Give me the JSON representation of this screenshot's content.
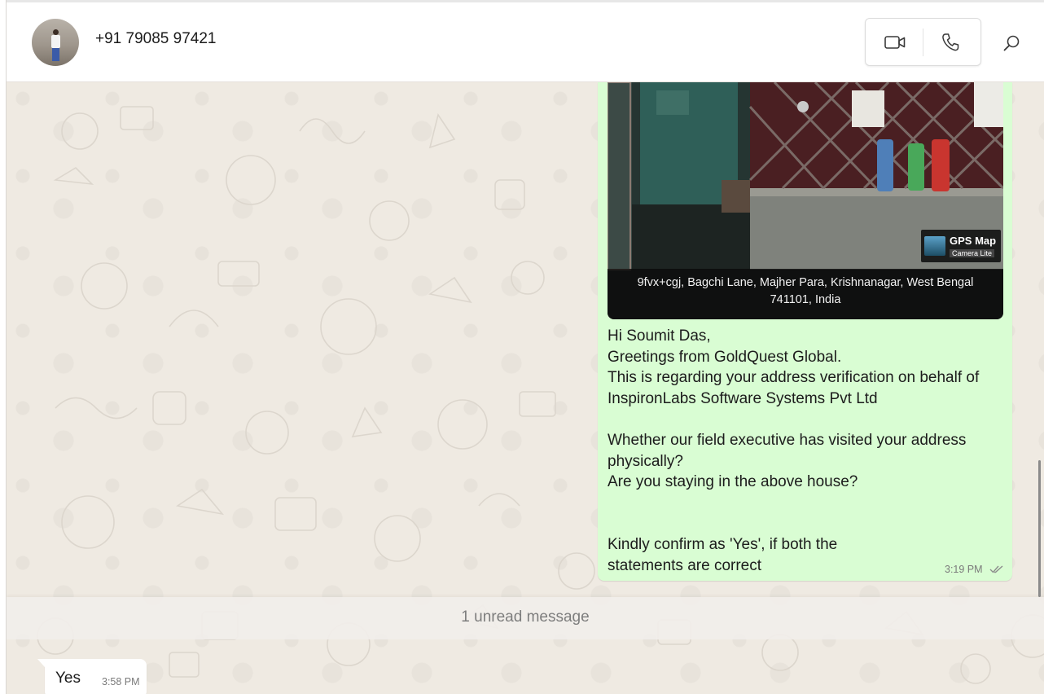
{
  "header": {
    "contact_name": "+91 79085 97421",
    "icons": {
      "video": "video-camera-icon",
      "call": "phone-icon",
      "search": "search-icon"
    }
  },
  "messages": {
    "outgoing": {
      "photo_caption": "9fvx+cgj, Bagchi Lane, Majher Para, Krishnanagar, West Bengal\n741101, India",
      "watermark_title": "GPS Map",
      "watermark_sub": "Camera Lite",
      "text": "Hi Soumit Das,\nGreetings from GoldQuest Global.\nThis is regarding your address verification on behalf of\nInspironLabs Software Systems Pvt Ltd\n\nWhether our field executive has visited your address\nphysically?\nAre you staying in the above house?\n\n\nKindly confirm as 'Yes', if both the\nstatements are correct",
      "time": "3:19 PM",
      "status_icon": "double-check-icon"
    },
    "unread_banner": "1 unread message",
    "incoming": {
      "text": "Yes",
      "time": "3:58 PM"
    }
  },
  "colors": {
    "outgoing_bubble": "#d9fdd3",
    "incoming_bubble": "#ffffff",
    "chat_background": "#efeae2"
  }
}
